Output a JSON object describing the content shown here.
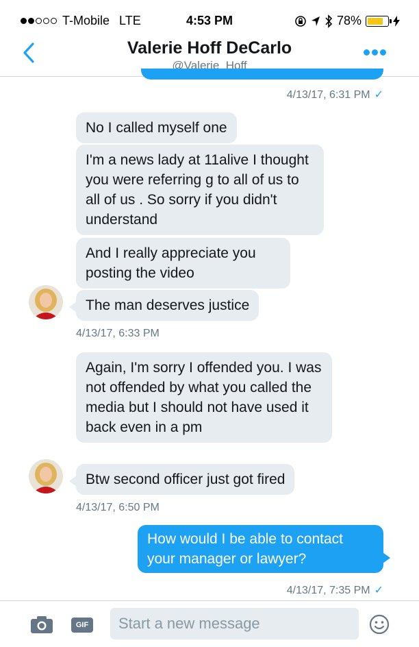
{
  "status_bar": {
    "carrier": "T-Mobile",
    "network": "LTE",
    "time": "4:53 PM",
    "battery_percent_label": "78%",
    "battery_level": 0.78,
    "signal_bars": 2,
    "signal_total": 5,
    "icons": [
      "lock-rotation-icon",
      "location-arrow-icon",
      "bluetooth-icon",
      "battery-icon",
      "charging-bolt-icon"
    ]
  },
  "header": {
    "title": "Valerie Hoff DeCarlo",
    "handle": "@Valerie_Hoff",
    "back_icon": "chevron-left-icon",
    "more_icon": "more-dots-icon",
    "accent_color": "#1da1f2"
  },
  "messages": [
    {
      "timestamp": "4/13/17, 6:31 PM",
      "read_check": "✓"
    },
    {
      "text": "No I called myself one"
    },
    {
      "text": "I'm a news lady at 11alive I thought you were referring g to all of us to all of us . So sorry if you didn't understand"
    },
    {
      "text": "And I really appreciate you posting the video"
    },
    {
      "text": "The man deserves justice"
    },
    {
      "timestamp": "4/13/17, 6:33 PM"
    },
    {
      "text": "Again, I'm sorry I offended you. I was not offended by what you called the media but I should not have used it back even in a pm"
    },
    {
      "text": "Btw second officer just got fired"
    },
    {
      "timestamp": "4/13/17, 6:50 PM"
    },
    {
      "text": "How would I be able to contact your manager or lawyer?"
    },
    {
      "timestamp": "4/13/17, 7:35 PM",
      "read_check": "✓"
    }
  ],
  "composer": {
    "placeholder": "Start a new message",
    "gif_label": "GIF",
    "camera_icon": "camera-icon",
    "emoji_icon": "emoji-icon"
  },
  "colors": {
    "received_bubble": "#e6ecf0",
    "sent_bubble": "#1da1f2",
    "muted_text": "#657786"
  }
}
